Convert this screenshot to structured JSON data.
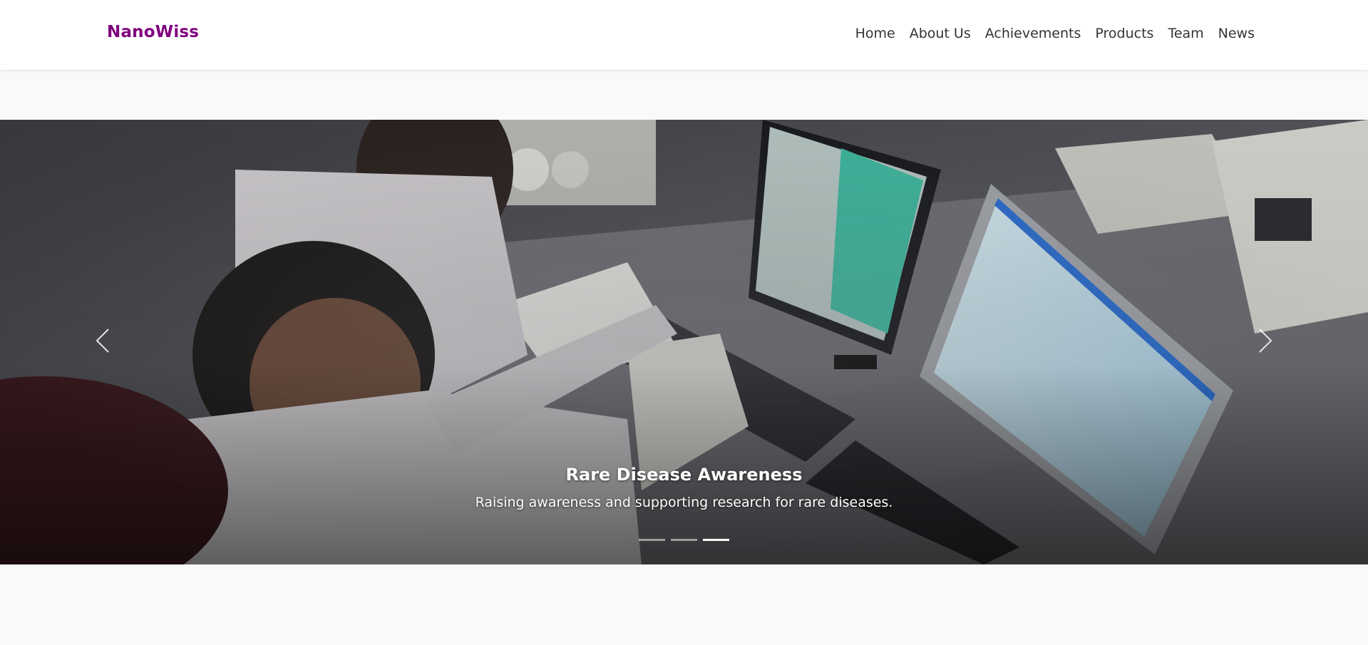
{
  "navbar": {
    "brand": "NanoWiss",
    "brand_color": "#800080",
    "links": [
      {
        "label": "Home"
      },
      {
        "label": "About Us"
      },
      {
        "label": "Achievements"
      },
      {
        "label": "Products"
      },
      {
        "label": "Team"
      },
      {
        "label": "News"
      }
    ]
  },
  "carousel": {
    "slide_count": 3,
    "active_index": 2,
    "active_slide": {
      "title": "Rare Disease Awareness",
      "description": "Raising awareness and supporting research for rare diseases.",
      "image": "photo of two researchers in lab coats at computer monitors showing microscopy images"
    },
    "prev_icon": "chevron-left-icon",
    "next_icon": "chevron-right-icon"
  },
  "colors": {
    "page_background": "#f8f9fa",
    "navbar_background": "#ffffff",
    "nav_text": "#333333",
    "caption_text": "#ffffff"
  }
}
